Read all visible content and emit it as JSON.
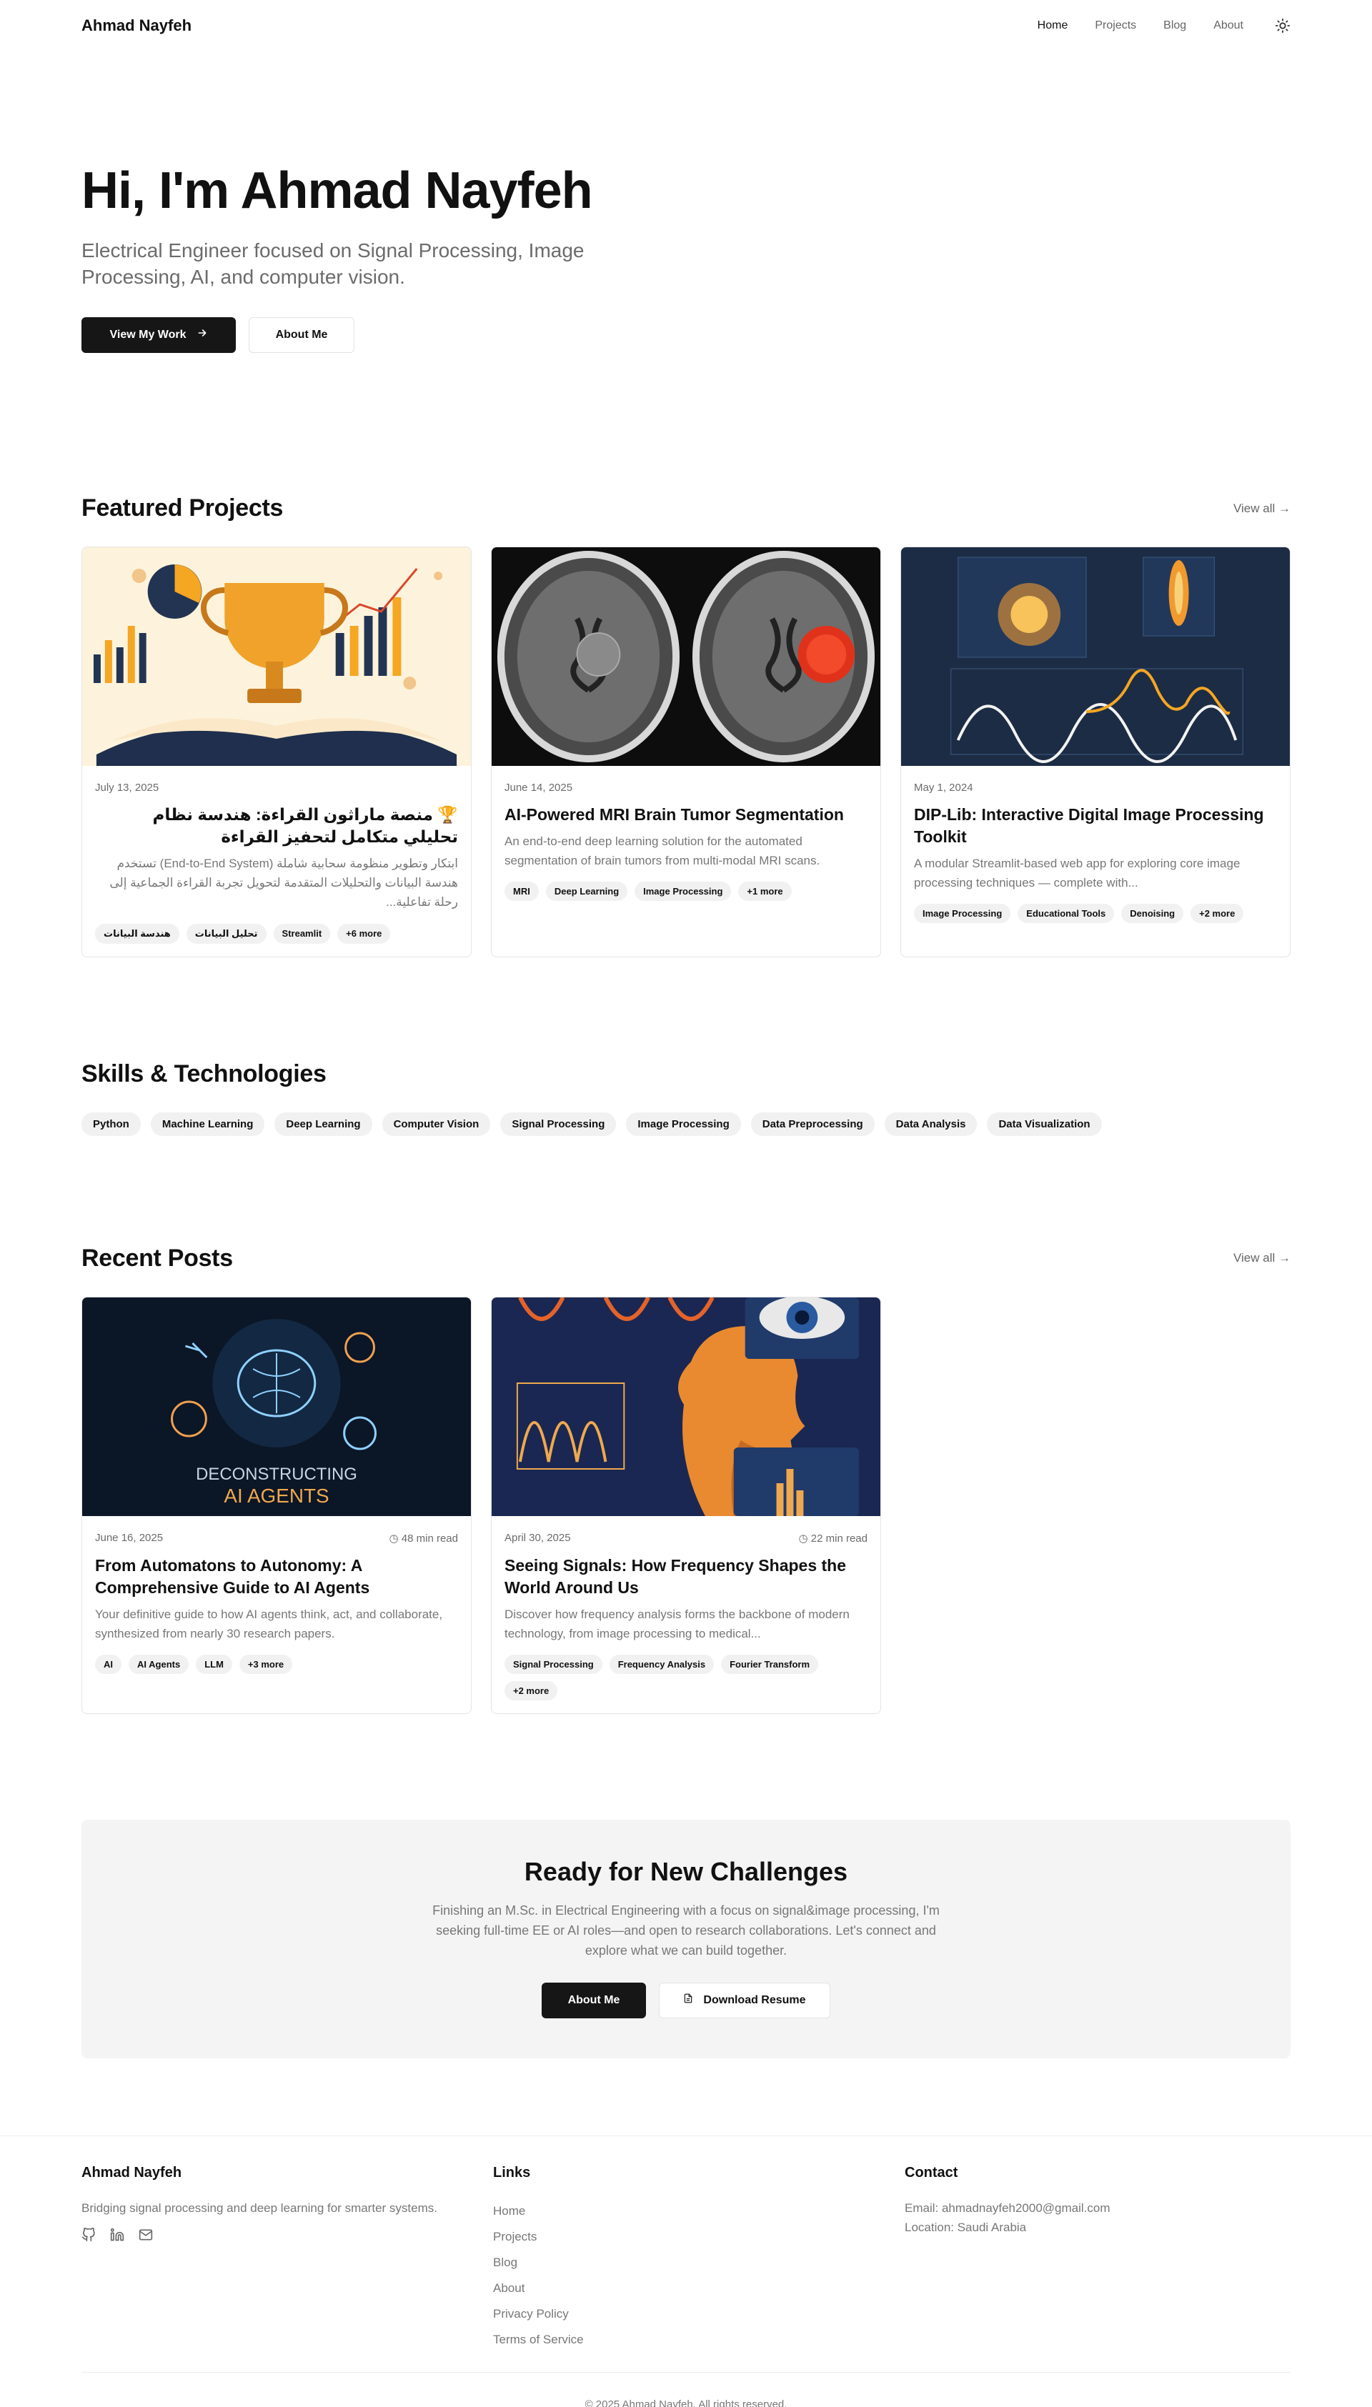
{
  "header": {
    "brand": "Ahmad Nayfeh",
    "nav": [
      {
        "label": "Home",
        "active": true
      },
      {
        "label": "Projects",
        "active": false
      },
      {
        "label": "Blog",
        "active": false
      },
      {
        "label": "About",
        "active": false
      }
    ],
    "theme_icon": "sun-icon"
  },
  "hero": {
    "title": "Hi, I'm Ahmad Nayfeh",
    "subtitle": "Electrical Engineer focused on Signal Processing, Image Processing, AI, and computer vision.",
    "primary_button": "View My Work",
    "secondary_button": "About Me"
  },
  "projects": {
    "heading": "Featured Projects",
    "view_all": "View all",
    "items": [
      {
        "date": "July 13, 2025",
        "title": "🏆 منصة ماراثون القراءة: هندسة نظام تحليلي متكامل لتحفيز القراءة",
        "desc": "ابتكار وتطوير منظومة سحابية شاملة (End-to-End System) تستخدم هندسة البيانات والتحليلات المتقدمة لتحويل تجربة القراءة الجماعية إلى رحلة تفاعلية...",
        "tags": [
          "هندسة البيانات",
          "تحليل البيانات",
          "Streamlit",
          "+6 more"
        ]
      },
      {
        "date": "June 14, 2025",
        "title": "AI-Powered MRI Brain Tumor Segmentation",
        "desc": "An end-to-end deep learning solution for the automated segmentation of brain tumors from multi-modal MRI scans.",
        "tags": [
          "MRI",
          "Deep Learning",
          "Image Processing",
          "+1 more"
        ]
      },
      {
        "date": "May 1, 2024",
        "title": "DIP-Lib: Interactive Digital Image Processing Toolkit",
        "desc": "A modular Streamlit-based web app for exploring core image processing techniques — complete with...",
        "tags": [
          "Image Processing",
          "Educational Tools",
          "Denoising",
          "+2 more"
        ]
      }
    ]
  },
  "skills": {
    "heading": "Skills & Technologies",
    "items": [
      "Python",
      "Machine Learning",
      "Deep Learning",
      "Computer Vision",
      "Signal Processing",
      "Image Processing",
      "Data Preprocessing",
      "Data Analysis",
      "Data Visualization"
    ]
  },
  "posts": {
    "heading": "Recent Posts",
    "view_all": "View all",
    "items": [
      {
        "date": "June 16, 2025",
        "read": "48 min read",
        "image_text_1": "DECONSTRUCTING",
        "image_text_2": "AI AGENTS",
        "title": "From Automatons to Autonomy: A Comprehensive Guide to AI Agents",
        "desc": "Your definitive guide to how AI agents think, act, and collaborate, synthesized from nearly 30 research papers.",
        "tags": [
          "AI",
          "AI Agents",
          "LLM",
          "+3 more"
        ]
      },
      {
        "date": "April 30, 2025",
        "read": "22 min read",
        "title": "Seeing Signals: How Frequency Shapes the World Around Us",
        "desc": "Discover how frequency analysis forms the backbone of modern technology, from image processing to medical...",
        "tags": [
          "Signal Processing",
          "Frequency Analysis",
          "Fourier Transform",
          "+2 more"
        ]
      }
    ]
  },
  "cta": {
    "title": "Ready for New Challenges",
    "text": "Finishing an M.Sc. in Electrical Engineering with a focus on signal&image processing, I'm seeking full-time EE or AI roles—and open to research collaborations. Let's connect and explore what we can build together.",
    "primary_button": "About Me",
    "secondary_button": "Download Resume"
  },
  "footer": {
    "brand": "Ahmad Nayfeh",
    "tagline": "Bridging signal processing and deep learning for smarter systems.",
    "links_heading": "Links",
    "links": [
      "Home",
      "Projects",
      "Blog",
      "About",
      "Privacy Policy",
      "Terms of Service"
    ],
    "contact_heading": "Contact",
    "email": "Email: ahmadnayfeh2000@gmail.com",
    "location": "Location: Saudi Arabia",
    "copyright": "© 2025 Ahmad Nayfeh. All rights reserved."
  }
}
